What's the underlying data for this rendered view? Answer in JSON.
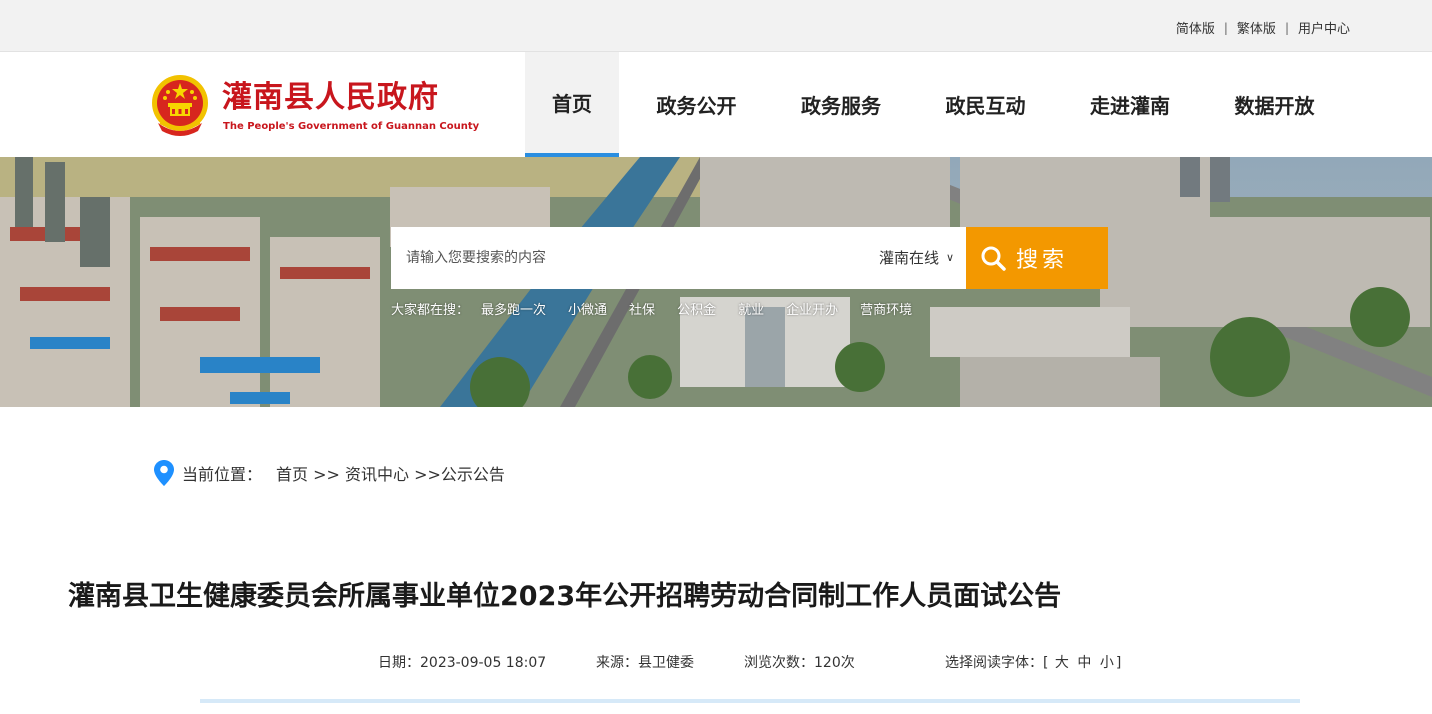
{
  "topbar": {
    "links": [
      "简体版",
      "繁体版",
      "用户中心"
    ],
    "separator": "|"
  },
  "header": {
    "logo_cn": "灌南县人民政府",
    "logo_en": "The People's Government of Guannan County",
    "nav": [
      "首页",
      "政务公开",
      "政务服务",
      "政民互动",
      "走进灌南",
      "数据开放"
    ],
    "active_nav": "首页",
    "accent_color": "#2a8ee0",
    "brand_color": "#c8161d"
  },
  "search": {
    "placeholder": "请输入您要搜索的内容",
    "scope_selected": "灌南在线",
    "button_label": "搜索",
    "button_color": "#f39800",
    "hot_label": "大家都在搜：",
    "hot_keywords": [
      "最多跑一次",
      "小微通",
      "社保",
      "公积金",
      "就业",
      "企业开办",
      "营商环境"
    ]
  },
  "breadcrumb": {
    "label": "当前位置：",
    "path": "首页 >> 资讯中心 >>公示公告"
  },
  "article": {
    "title": "灌南县卫生健康委员会所属事业单位2023年公开招聘劳动合同制工作人员面试公告",
    "date": "日期：2023-09-05 18:07",
    "source": "来源：县卫健委",
    "views": "浏览次数：120次",
    "font_size_label": "选择阅读字体：",
    "font_size_options": [
      "大",
      "中",
      "小"
    ]
  }
}
